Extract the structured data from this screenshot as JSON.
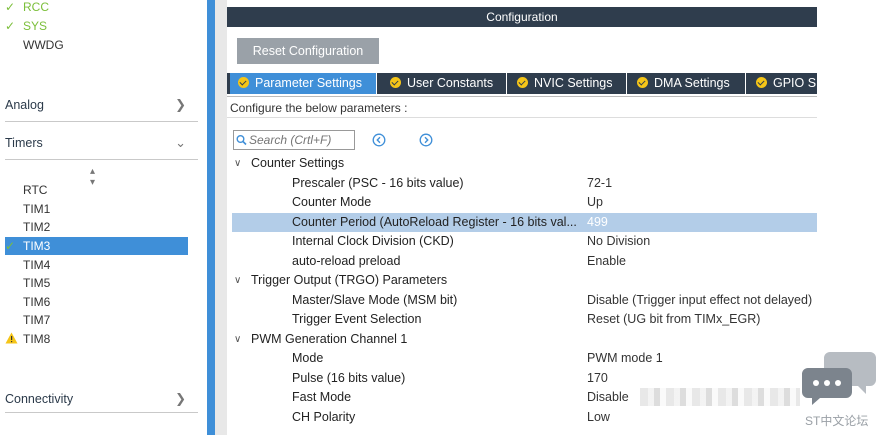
{
  "left": {
    "top_items": [
      {
        "label": "RCC",
        "checked": true
      },
      {
        "label": "SYS",
        "checked": true
      },
      {
        "label": "WWDG",
        "checked": false
      }
    ],
    "categories": {
      "analog": "Analog",
      "timers": "Timers",
      "connectivity": "Connectivity"
    },
    "timer_items": [
      {
        "label": "RTC",
        "status": "none"
      },
      {
        "label": "TIM1",
        "status": "none"
      },
      {
        "label": "TIM2",
        "status": "none"
      },
      {
        "label": "TIM3",
        "status": "checked",
        "selected": true
      },
      {
        "label": "TIM4",
        "status": "none"
      },
      {
        "label": "TIM5",
        "status": "none"
      },
      {
        "label": "TIM6",
        "status": "none"
      },
      {
        "label": "TIM7",
        "status": "none"
      },
      {
        "label": "TIM8",
        "status": "warning"
      }
    ]
  },
  "config": {
    "title": "Configuration",
    "reset_button": "Reset Configuration",
    "tabs": [
      "Parameter Settings",
      "User Constants",
      "NVIC Settings",
      "DMA Settings",
      "GPIO S"
    ],
    "configure_text": "Configure the below parameters :",
    "search_placeholder": "Search (Crtl+F)"
  },
  "groups": [
    {
      "name": "Counter Settings",
      "params": [
        {
          "name": "Prescaler (PSC - 16 bits value)",
          "value": "72-1"
        },
        {
          "name": "Counter Mode",
          "value": "Up"
        },
        {
          "name": "Counter Period (AutoReload Register - 16 bits val...",
          "value": "499",
          "highlight": true
        },
        {
          "name": "Internal Clock Division (CKD)",
          "value": "No Division"
        },
        {
          "name": "auto-reload preload",
          "value": "Enable"
        }
      ]
    },
    {
      "name": "Trigger Output (TRGO) Parameters",
      "params": [
        {
          "name": "Master/Slave Mode (MSM bit)",
          "value": "Disable (Trigger input effect not delayed)"
        },
        {
          "name": "Trigger Event Selection",
          "value": "Reset (UG bit from TIMx_EGR)"
        }
      ]
    },
    {
      "name": "PWM Generation Channel 1",
      "params": [
        {
          "name": "Mode",
          "value": "PWM mode 1"
        },
        {
          "name": "Pulse (16 bits value)",
          "value": "170"
        },
        {
          "name": "Fast Mode",
          "value": "Disable"
        },
        {
          "name": "CH Polarity",
          "value": "Low"
        }
      ]
    }
  ],
  "watermark": {
    "text": "ST中文论坛"
  },
  "colors": {
    "accent": "#3f8fd8",
    "dark_header": "#2f3d4d",
    "check_green": "#7bbf3a",
    "warning_yellow": "#f5c518"
  }
}
